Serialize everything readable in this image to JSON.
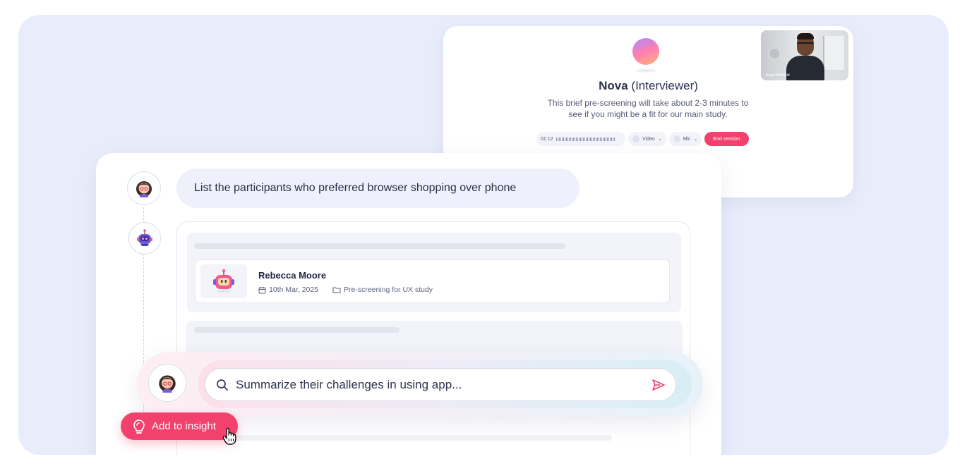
{
  "interview": {
    "agent_name": "Nova",
    "agent_role": "(Interviewer)",
    "description": "This brief pre-screening will take about 2-3 minutes to see if you might be a fit for our main study.",
    "timer": "01:12",
    "video_label": "Video",
    "mic_label": "Mic",
    "end_label": "End session",
    "participant_video_name": "Adam Whitfield"
  },
  "chat": {
    "user_query": "List the participants who preferred browser shopping over phone",
    "results": [
      {
        "name": "Rebecca Moore",
        "date": "10th Mar, 2025",
        "study": "Pre-screening for UX study"
      }
    ]
  },
  "prompt": {
    "value": "Summarize their challenges in using app..."
  },
  "actions": {
    "add_to_insight": "Add to insight"
  },
  "colors": {
    "background": "#e9edfb",
    "accent": "#f2416d",
    "user_bubble": "#eef1fb"
  },
  "icons": [
    "user-avatar-icon",
    "robot-avatar-icon",
    "calendar-icon",
    "folder-icon",
    "search-icon",
    "send-icon",
    "lightbulb-icon",
    "hand-cursor-icon",
    "mic-icon"
  ]
}
